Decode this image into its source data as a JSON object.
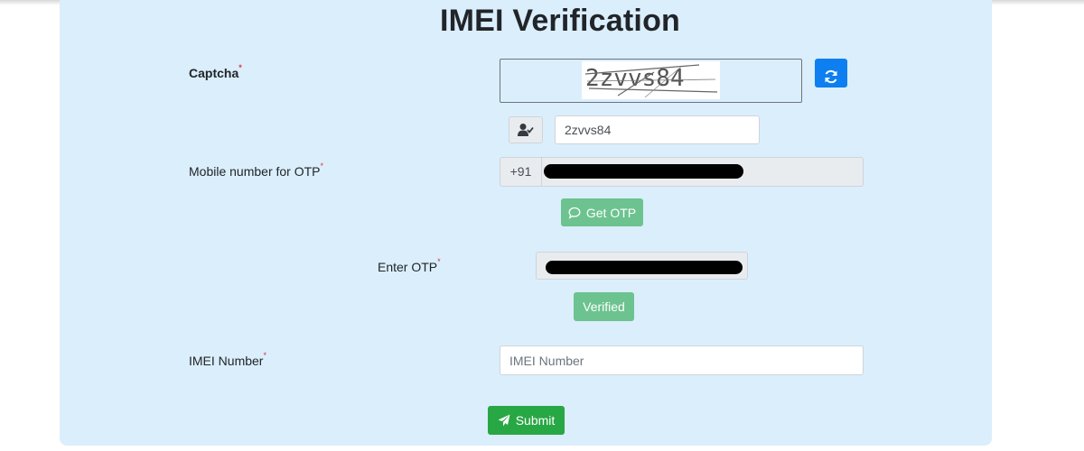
{
  "page": {
    "title": "IMEI Verification"
  },
  "colors": {
    "panel_bg": "#dbeefc",
    "primary": "#0d7ff0",
    "success": "#28a745",
    "success_light": "#6cc38f",
    "required": "#dc3545"
  },
  "captcha": {
    "label": "Captcha",
    "required_mark": "*",
    "image_text": "2zvvs84",
    "refresh_icon": "refresh-icon",
    "input_icon": "user-check-icon",
    "input_value": "2zvvs84"
  },
  "mobile": {
    "label": "Mobile number for OTP",
    "required_mark": "*",
    "prefix": "+91"
  },
  "get_otp": {
    "label": "Get OTP",
    "icon": "chat-bubble-icon"
  },
  "otp": {
    "label": "Enter OTP",
    "required_mark": "*"
  },
  "verified": {
    "label": "Verified"
  },
  "imei": {
    "label": "IMEI Number",
    "required_mark": "*",
    "placeholder": "IMEI Number",
    "value": ""
  },
  "submit": {
    "label": "Submit",
    "icon": "paper-plane-icon"
  }
}
